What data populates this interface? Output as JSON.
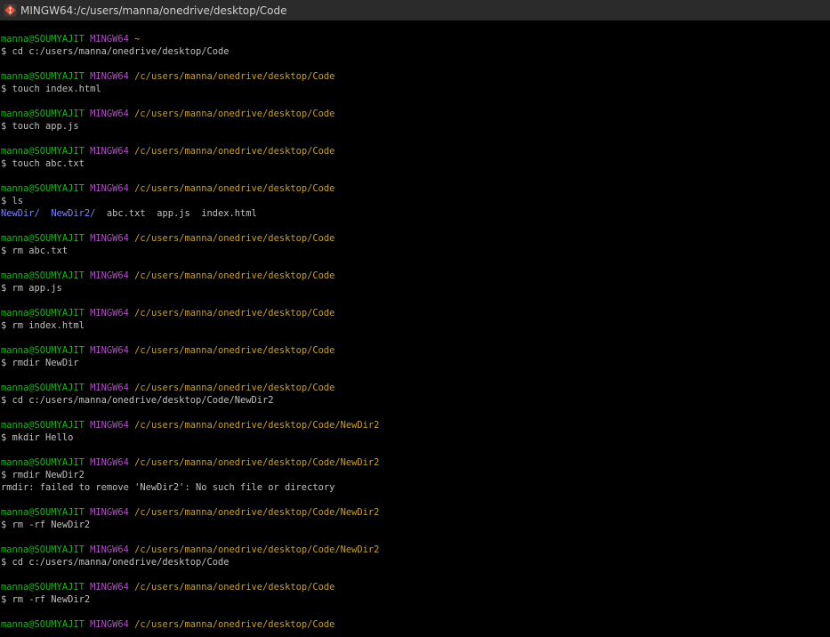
{
  "window": {
    "title": "MINGW64:/c/users/manna/onedrive/desktop/Code"
  },
  "colors": {
    "user": "#19b719",
    "host": "#b14fc5",
    "path": "#c8a21f",
    "dir": "#7b83ff",
    "text": "#c0c0c0",
    "background": "#000000",
    "titlebar": "#2b2b2b"
  },
  "terminal": {
    "blocks": [
      {
        "user": "manna@SOUMYAJIT",
        "host": "MINGW64",
        "path": "~",
        "command": "$ cd c:/users/manna/onedrive/desktop/Code"
      },
      {
        "user": "manna@SOUMYAJIT",
        "host": "MINGW64",
        "path": "/c/users/manna/onedrive/desktop/Code",
        "command": "$ touch index.html"
      },
      {
        "user": "manna@SOUMYAJIT",
        "host": "MINGW64",
        "path": "/c/users/manna/onedrive/desktop/Code",
        "command": "$ touch app.js"
      },
      {
        "user": "manna@SOUMYAJIT",
        "host": "MINGW64",
        "path": "/c/users/manna/onedrive/desktop/Code",
        "command": "$ touch abc.txt"
      },
      {
        "user": "manna@SOUMYAJIT",
        "host": "MINGW64",
        "path": "/c/users/manna/onedrive/desktop/Code",
        "command": "$ ls",
        "ls_output": {
          "dirs": [
            "NewDir/",
            "NewDir2/"
          ],
          "files": [
            "abc.txt",
            "app.js",
            "index.html"
          ]
        }
      },
      {
        "user": "manna@SOUMYAJIT",
        "host": "MINGW64",
        "path": "/c/users/manna/onedrive/desktop/Code",
        "command": "$ rm abc.txt"
      },
      {
        "user": "manna@SOUMYAJIT",
        "host": "MINGW64",
        "path": "/c/users/manna/onedrive/desktop/Code",
        "command": "$ rm app.js"
      },
      {
        "user": "manna@SOUMYAJIT",
        "host": "MINGW64",
        "path": "/c/users/manna/onedrive/desktop/Code",
        "command": "$ rm index.html"
      },
      {
        "user": "manna@SOUMYAJIT",
        "host": "MINGW64",
        "path": "/c/users/manna/onedrive/desktop/Code",
        "command": "$ rmdir NewDir"
      },
      {
        "user": "manna@SOUMYAJIT",
        "host": "MINGW64",
        "path": "/c/users/manna/onedrive/desktop/Code",
        "command": "$ cd c:/users/manna/onedrive/desktop/Code/NewDir2"
      },
      {
        "user": "manna@SOUMYAJIT",
        "host": "MINGW64",
        "path": "/c/users/manna/onedrive/desktop/Code/NewDir2",
        "command": "$ mkdir Hello"
      },
      {
        "user": "manna@SOUMYAJIT",
        "host": "MINGW64",
        "path": "/c/users/manna/onedrive/desktop/Code/NewDir2",
        "command": "$ rmdir NewDir2",
        "output": "rmdir: failed to remove 'NewDir2': No such file or directory"
      },
      {
        "user": "manna@SOUMYAJIT",
        "host": "MINGW64",
        "path": "/c/users/manna/onedrive/desktop/Code/NewDir2",
        "command": "$ rm -rf NewDir2"
      },
      {
        "user": "manna@SOUMYAJIT",
        "host": "MINGW64",
        "path": "/c/users/manna/onedrive/desktop/Code/NewDir2",
        "command": "$ cd c:/users/manna/onedrive/desktop/Code"
      },
      {
        "user": "manna@SOUMYAJIT",
        "host": "MINGW64",
        "path": "/c/users/manna/onedrive/desktop/Code",
        "command": "$ rm -rf NewDir2"
      },
      {
        "user": "manna@SOUMYAJIT",
        "host": "MINGW64",
        "path": "/c/users/manna/onedrive/desktop/Code"
      }
    ]
  }
}
